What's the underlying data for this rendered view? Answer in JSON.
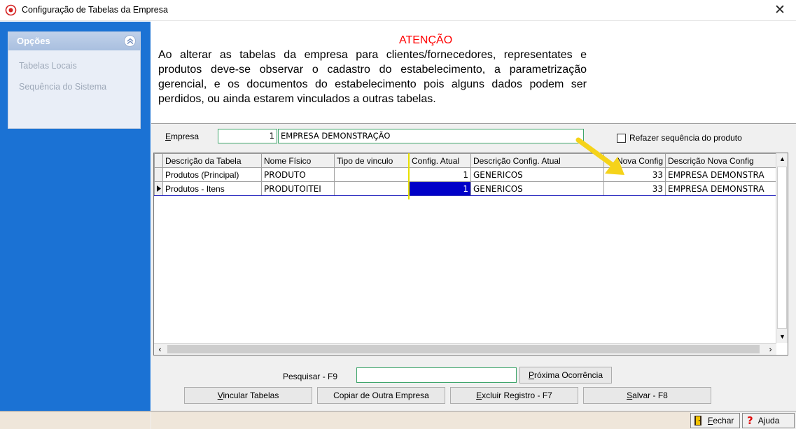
{
  "window": {
    "title": "Configuração de Tabelas da Empresa",
    "close_glyph": "✕"
  },
  "sidebar": {
    "panel_title": "Opções",
    "items": [
      {
        "label": "Tabelas Locais"
      },
      {
        "label": "Sequência do Sistema"
      }
    ]
  },
  "warning": {
    "title": "ATENÇÃO",
    "text": "Ao alterar as tabelas da empresa para clientes/fornecedores, representates e produtos deve-se observar o cadastro do estabelecimento, a parametrização gerencial, e os documentos do estabelecimento pois alguns dados podem ser perdidos, ou ainda estarem vinculados a outras tabelas."
  },
  "empresa": {
    "label_first": "E",
    "label_rest": "mpresa",
    "code": "1",
    "name": "EMPRESA DEMONSTRAÇÃO",
    "refazer_label": "Refazer sequência do produto",
    "refazer_checked": false
  },
  "grid": {
    "columns": [
      "Descrição da Tabela",
      "Nome Físico",
      "Tipo de vinculo",
      "Config. Atual",
      "Descrição Config. Atual",
      "Nova Config",
      "Descrição Nova Config"
    ],
    "rows": [
      {
        "descricao": "Produtos (Principal)",
        "nome_fisico": "PRODUTO",
        "tipo_vinculo": "",
        "config_atual": "1",
        "desc_config_atual": "GENERICOS",
        "nova_config": "33",
        "desc_nova_config": "EMPRESA DEMONSTRA"
      },
      {
        "descricao": "Produtos - Itens",
        "nome_fisico": "PRODUTOITEI",
        "tipo_vinculo": "",
        "config_atual": "1",
        "desc_config_atual": "GENERICOS",
        "nova_config": "33",
        "desc_nova_config": "EMPRESA DEMONSTRA"
      }
    ]
  },
  "search": {
    "label": "Pesquisar - F9",
    "value": "",
    "next_first": "P",
    "next_rest": "róxima Ocorrência"
  },
  "actions": {
    "vincular_first": "V",
    "vincular_rest": "incular Tabelas",
    "copiar": "Copiar de Outra Empresa",
    "excluir_first": "E",
    "excluir_rest": "xcluir Registro - F7",
    "salvar_first": "S",
    "salvar_rest": "alvar - F8"
  },
  "statusbar": {
    "fechar_first": "F",
    "fechar_rest": "echar",
    "ajuda": "Ajuda"
  },
  "colors": {
    "sidebar": "#1b72d4",
    "warning_title": "#ff0000",
    "selection": "#0000c8",
    "arrow": "#f5d31a"
  }
}
